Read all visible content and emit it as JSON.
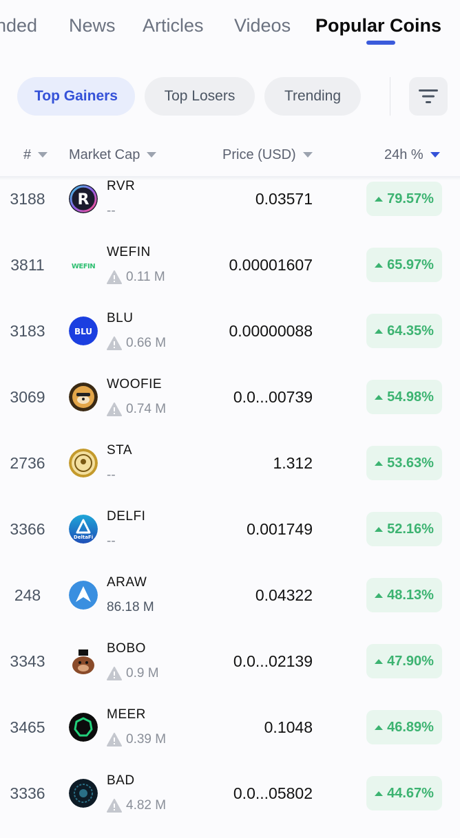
{
  "tabs": [
    "nded",
    "News",
    "Articles",
    "Videos",
    "Popular Coins"
  ],
  "active_tab": "Popular Coins",
  "chips": [
    "Top Gainers",
    "Top Losers",
    "Trending"
  ],
  "active_chip": "Top Gainers",
  "columns": {
    "rank": "#",
    "market_cap": "Market Cap",
    "price": "Price (USD)",
    "change": "24h %"
  },
  "colors": {
    "accent": "#3552d8",
    "positive": "#3cb371",
    "positive_bg": "#e8f6ee"
  },
  "rows": [
    {
      "rank": "3188",
      "symbol": "RVR",
      "mcap": "--",
      "warn": false,
      "price": "0.03571",
      "change": "79.57%",
      "logo": "rvr-logo"
    },
    {
      "rank": "3811",
      "symbol": "WEFIN",
      "mcap": "0.11 M",
      "warn": true,
      "price": "0.00001607",
      "change": "65.97%",
      "logo": "wefin-logo"
    },
    {
      "rank": "3183",
      "symbol": "BLU",
      "mcap": "0.66 M",
      "warn": true,
      "price": "0.00000088",
      "change": "64.35%",
      "logo": "blu-logo"
    },
    {
      "rank": "3069",
      "symbol": "WOOFIE",
      "mcap": "0.74 M",
      "warn": true,
      "price": "0.0...00739",
      "change": "54.98%",
      "logo": "woofie-logo"
    },
    {
      "rank": "2736",
      "symbol": "STA",
      "mcap": "--",
      "warn": false,
      "price": "1.312",
      "change": "53.63%",
      "logo": "sta-logo"
    },
    {
      "rank": "3366",
      "symbol": "DELFI",
      "mcap": "--",
      "warn": false,
      "price": "0.001749",
      "change": "52.16%",
      "logo": "deltafi-logo"
    },
    {
      "rank": "248",
      "symbol": "ARAW",
      "mcap": "86.18 M",
      "warn": false,
      "price": "0.04322",
      "change": "48.13%",
      "logo": "araw-logo"
    },
    {
      "rank": "3343",
      "symbol": "BOBO",
      "mcap": "0.9 M",
      "warn": true,
      "price": "0.0...02139",
      "change": "47.90%",
      "logo": "bobo-logo"
    },
    {
      "rank": "3465",
      "symbol": "MEER",
      "mcap": "0.39 M",
      "warn": true,
      "price": "0.1048",
      "change": "46.89%",
      "logo": "meer-logo"
    },
    {
      "rank": "3336",
      "symbol": "BAD",
      "mcap": "4.82 M",
      "warn": true,
      "price": "0.0...05802",
      "change": "44.67%",
      "logo": "bad-logo"
    }
  ],
  "logo_text": {
    "rvr-logo": "R",
    "wefin-logo": "WEFIN",
    "blu-logo": "BLU",
    "deltafi-logo": "DeltaFi"
  }
}
